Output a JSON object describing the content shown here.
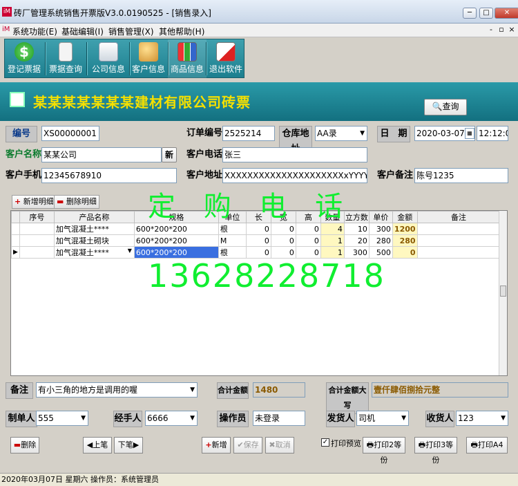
{
  "window": {
    "title": "砖厂管理系统销售开票版V3.0.0190525 - [销售录入]",
    "app_icon_text": "iM"
  },
  "menu": [
    "系统功能(E)",
    "基础编辑(I)",
    "销售管理(X)",
    "其他帮助(H)"
  ],
  "toolbar": [
    {
      "label": "登记票据",
      "icon": "dollar-coin-icon"
    },
    {
      "label": "票据查询",
      "icon": "document-search-icon"
    },
    {
      "label": "公司信息",
      "icon": "building-icon"
    },
    {
      "label": "客户信息",
      "icon": "users-icon"
    },
    {
      "label": "商品信息",
      "icon": "chart-icon"
    },
    {
      "label": "退出软件",
      "icon": "exit-icon"
    }
  ],
  "header": {
    "title": "某某某某某某某建材有限公司砖票",
    "query_button": "查询"
  },
  "form": {
    "number_label": "编号",
    "number": "XS00000001",
    "order_label": "订单编号",
    "order": "2525214",
    "warehouse_label": "仓库地址",
    "warehouse": "AA录",
    "date_label": "日　期",
    "date": "2020-03-07",
    "time": "12:12:0",
    "customer_label": "客户名称",
    "customer": "某某公司",
    "new_button": "新",
    "phone_label": "客户电话",
    "phone": "张三",
    "mobile_label": "客户手机",
    "mobile": "12345678910",
    "address_label": "客户地址",
    "address": "XXXXXXXXXXXXXXXXXXXXXxYYYYYYYY",
    "note_label": "客户备注",
    "note": "陈号1235"
  },
  "detail_buttons": {
    "add": "新增明细",
    "delete": "删除明细"
  },
  "table": {
    "columns": [
      "序号",
      "产品名称",
      "规格",
      "单位",
      "长",
      "宽",
      "高",
      "数量",
      "立方数",
      "单价",
      "金额",
      "备注"
    ],
    "rows": [
      {
        "no": "",
        "name": "加气混凝土****",
        "spec": "600*200*200",
        "unit": "根",
        "l": "0",
        "w": "0",
        "h": "0",
        "qty": "4",
        "cube": "10",
        "price": "300",
        "amount": "1200",
        "remark": ""
      },
      {
        "no": "",
        "name": "加气混凝土砌块",
        "spec": "600*200*200",
        "unit": "M",
        "l": "0",
        "w": "0",
        "h": "0",
        "qty": "1",
        "cube": "20",
        "price": "280",
        "amount": "280",
        "remark": ""
      },
      {
        "no": "",
        "name": "加气混凝土****",
        "spec": "600*200*200",
        "unit": "根",
        "l": "0",
        "w": "0",
        "h": "0",
        "qty": "1",
        "cube": "300",
        "price": "500",
        "amount": "0",
        "remark": ""
      }
    ]
  },
  "watermark": {
    "line1": "定 购 电 话",
    "line2": "13628228718"
  },
  "footer": {
    "remark_label": "备注",
    "remark": "有小三角的地方是调用的喔",
    "total_label": "合计金额",
    "total": "1480",
    "total_upper_label": "合计金额大写",
    "total_upper": "壹仟肆佰捌拾元整",
    "maker_label": "制单人",
    "maker": "555",
    "handler_label": "经手人",
    "handler": "6666",
    "operator_label": "操作员",
    "operator": "未登录",
    "shipper_label": "发货人",
    "shipper": "司机",
    "receiver_label": "收货人",
    "receiver": "123"
  },
  "actions": {
    "delete": "删除",
    "prev": "上笔",
    "next": "下笔",
    "add": "新增",
    "save": "保存",
    "cancel": "取消",
    "preview": "打印预览",
    "print2": "打印2等份",
    "print3": "打印3等份",
    "print4": "打印A4"
  },
  "status": "2020年03月07日  星期六  操作员：系统管理员",
  "colors": {
    "teal": "#1c7f8f",
    "title_yellow": "#f5e000",
    "watermark": "#10ee30"
  }
}
